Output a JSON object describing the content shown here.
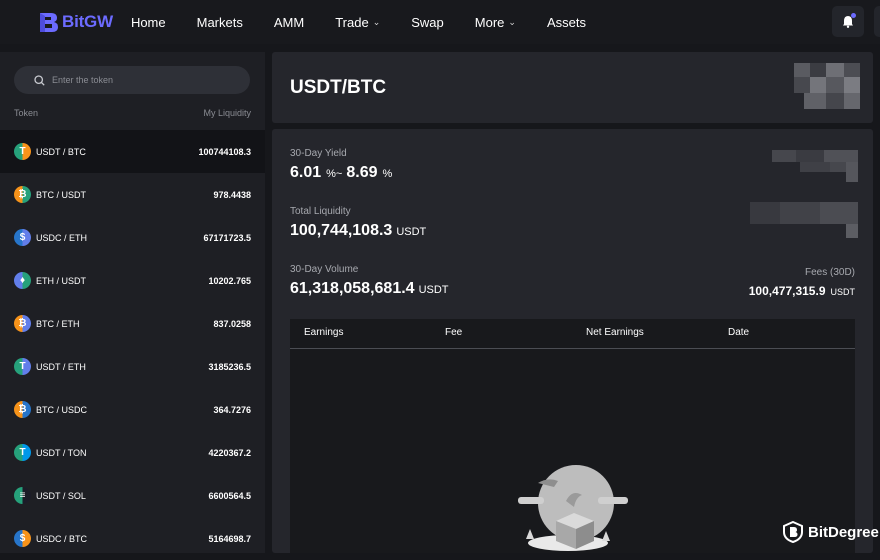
{
  "nav": {
    "logo": "BitGW",
    "links": [
      {
        "label": "Home"
      },
      {
        "label": "Markets"
      },
      {
        "label": "AMM"
      },
      {
        "label": "Trade",
        "dropdown": true
      },
      {
        "label": "Swap"
      },
      {
        "label": "More",
        "dropdown": true
      },
      {
        "label": "Assets"
      }
    ],
    "bell_icon": "bell-icon"
  },
  "sidebar": {
    "search_placeholder": "Enter the token",
    "col_token": "Token",
    "col_liquidity": "My Liquidity",
    "rows": [
      {
        "pair": "USDT / BTC",
        "liquidity": "100744108.3",
        "coin": "usdt",
        "active": true
      },
      {
        "pair": "BTC / USDT",
        "liquidity": "978.4438",
        "coin": "btc"
      },
      {
        "pair": "USDC / ETH",
        "liquidity": "67171723.5",
        "coin": "usdc"
      },
      {
        "pair": "ETH / USDT",
        "liquidity": "10202.765",
        "coin": "eth"
      },
      {
        "pair": "BTC / ETH",
        "liquidity": "837.0258",
        "coin": "btc"
      },
      {
        "pair": "USDT / ETH",
        "liquidity": "3185236.5",
        "coin": "usdt"
      },
      {
        "pair": "BTC / USDC",
        "liquidity": "364.7276",
        "coin": "btc"
      },
      {
        "pair": "USDT / TON",
        "liquidity": "4220367.2",
        "coin": "usdt-ton"
      },
      {
        "pair": "USDT / SOL",
        "liquidity": "6600564.5",
        "coin": "usdt-sol"
      },
      {
        "pair": "USDC / BTC",
        "liquidity": "5164698.7",
        "coin": "usdc"
      }
    ]
  },
  "main": {
    "title": "USDT/BTC",
    "yield_label": "30-Day Yield",
    "yield_low": "6.01",
    "yield_sep": "%~",
    "yield_high": "8.69",
    "yield_pct": "%",
    "liquidity_label": "Total Liquidity",
    "liquidity_value": "100,744,108.3",
    "liquidity_unit": "USDT",
    "volume_label": "30-Day Volume",
    "volume_value": "61,318,058,681.4",
    "volume_unit": "USDT",
    "fees_label": "Fees (30D)",
    "fees_value": "100,477,315.9",
    "fees_unit": "USDT",
    "table_headers": [
      "Earnings",
      "Fee",
      "Net Earnings",
      "Date"
    ]
  },
  "watermark": "BitDegree",
  "colors": {
    "brand": "#6c6bff",
    "usdt": "#26a17b",
    "btc": "#f7931a",
    "usdc": "#2775ca",
    "eth": "#627eea"
  }
}
